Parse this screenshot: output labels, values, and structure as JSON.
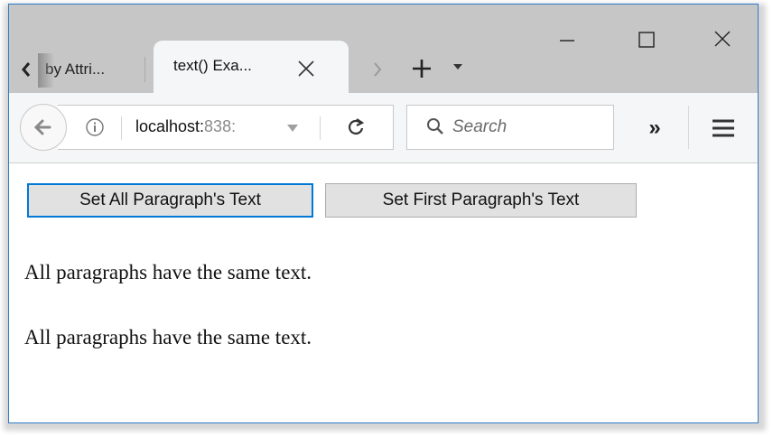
{
  "tabs": {
    "inactive": {
      "title": "by Attri..."
    },
    "active": {
      "title": "text() Exa..."
    }
  },
  "navbar": {
    "url_host": "localhost:",
    "url_port": "838:",
    "search_placeholder": "Search",
    "overflow_label": "»"
  },
  "page": {
    "buttons": {
      "set_all": "Set All Paragraph's Text",
      "set_first": "Set First Paragraph's Text"
    },
    "paragraphs": [
      "All paragraphs have the same text.",
      "All paragraphs have the same text."
    ]
  },
  "colors": {
    "focus_border": "#0078d7",
    "window_border": "#2f7cc8",
    "tabstrip": "#c6c6c6",
    "toolbar": "#f5f6f7"
  }
}
